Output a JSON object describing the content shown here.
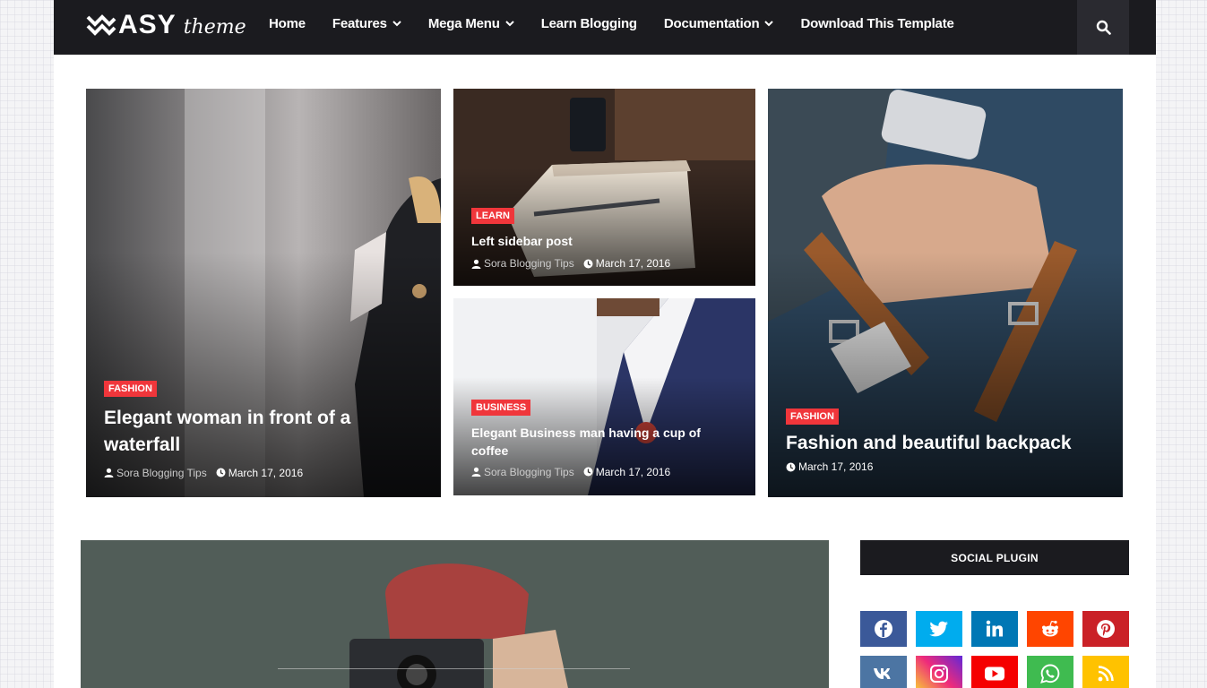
{
  "brand": {
    "logo_text": "ASY",
    "logo_sub": "theme"
  },
  "nav": {
    "items": [
      {
        "label": "Home",
        "dropdown": false
      },
      {
        "label": "Features",
        "dropdown": true
      },
      {
        "label": "Mega Menu",
        "dropdown": true
      },
      {
        "label": "Learn Blogging",
        "dropdown": false
      },
      {
        "label": "Documentation",
        "dropdown": true
      },
      {
        "label": "Download This Template",
        "dropdown": false
      }
    ],
    "search_icon": "search-icon"
  },
  "featured": [
    {
      "tag": "FASHION",
      "title": "Elegant woman in front of a waterfall",
      "author": "Sora Blogging Tips",
      "date": "March 17, 2016"
    },
    {
      "tag": "LEARN",
      "title": "Left sidebar post",
      "author": "Sora Blogging Tips",
      "date": "March 17, 2016"
    },
    {
      "tag": "BUSINESS",
      "title": "Elegant Business man having a cup of coffee",
      "author": "Sora Blogging Tips",
      "date": "March 17, 2016"
    },
    {
      "tag": "FASHION",
      "title": "Fashion and beautiful backpack",
      "date": "March 17, 2016"
    }
  ],
  "sidebar": {
    "social_title": "SOCIAL PLUGIN",
    "social": [
      {
        "icon": "facebook-icon",
        "color": "#3b5999"
      },
      {
        "icon": "twitter-icon",
        "color": "#00acee"
      },
      {
        "icon": "linkedin-icon",
        "color": "#0077b5"
      },
      {
        "icon": "reddit-icon",
        "color": "#ff4500"
      },
      {
        "icon": "pinterest-icon",
        "color": "#ca2127"
      },
      {
        "icon": "vk-icon",
        "color": "#4c75a3"
      },
      {
        "icon": "instagram-icon",
        "color": "#c13584"
      },
      {
        "icon": "youtube-icon",
        "color": "#f50000"
      },
      {
        "icon": "whatsapp-icon",
        "color": "#3fbb50"
      },
      {
        "icon": "rss-icon",
        "color": "#ffc200"
      }
    ]
  },
  "colors": {
    "accent": "#f0363b",
    "header": "#1b1b1f"
  }
}
